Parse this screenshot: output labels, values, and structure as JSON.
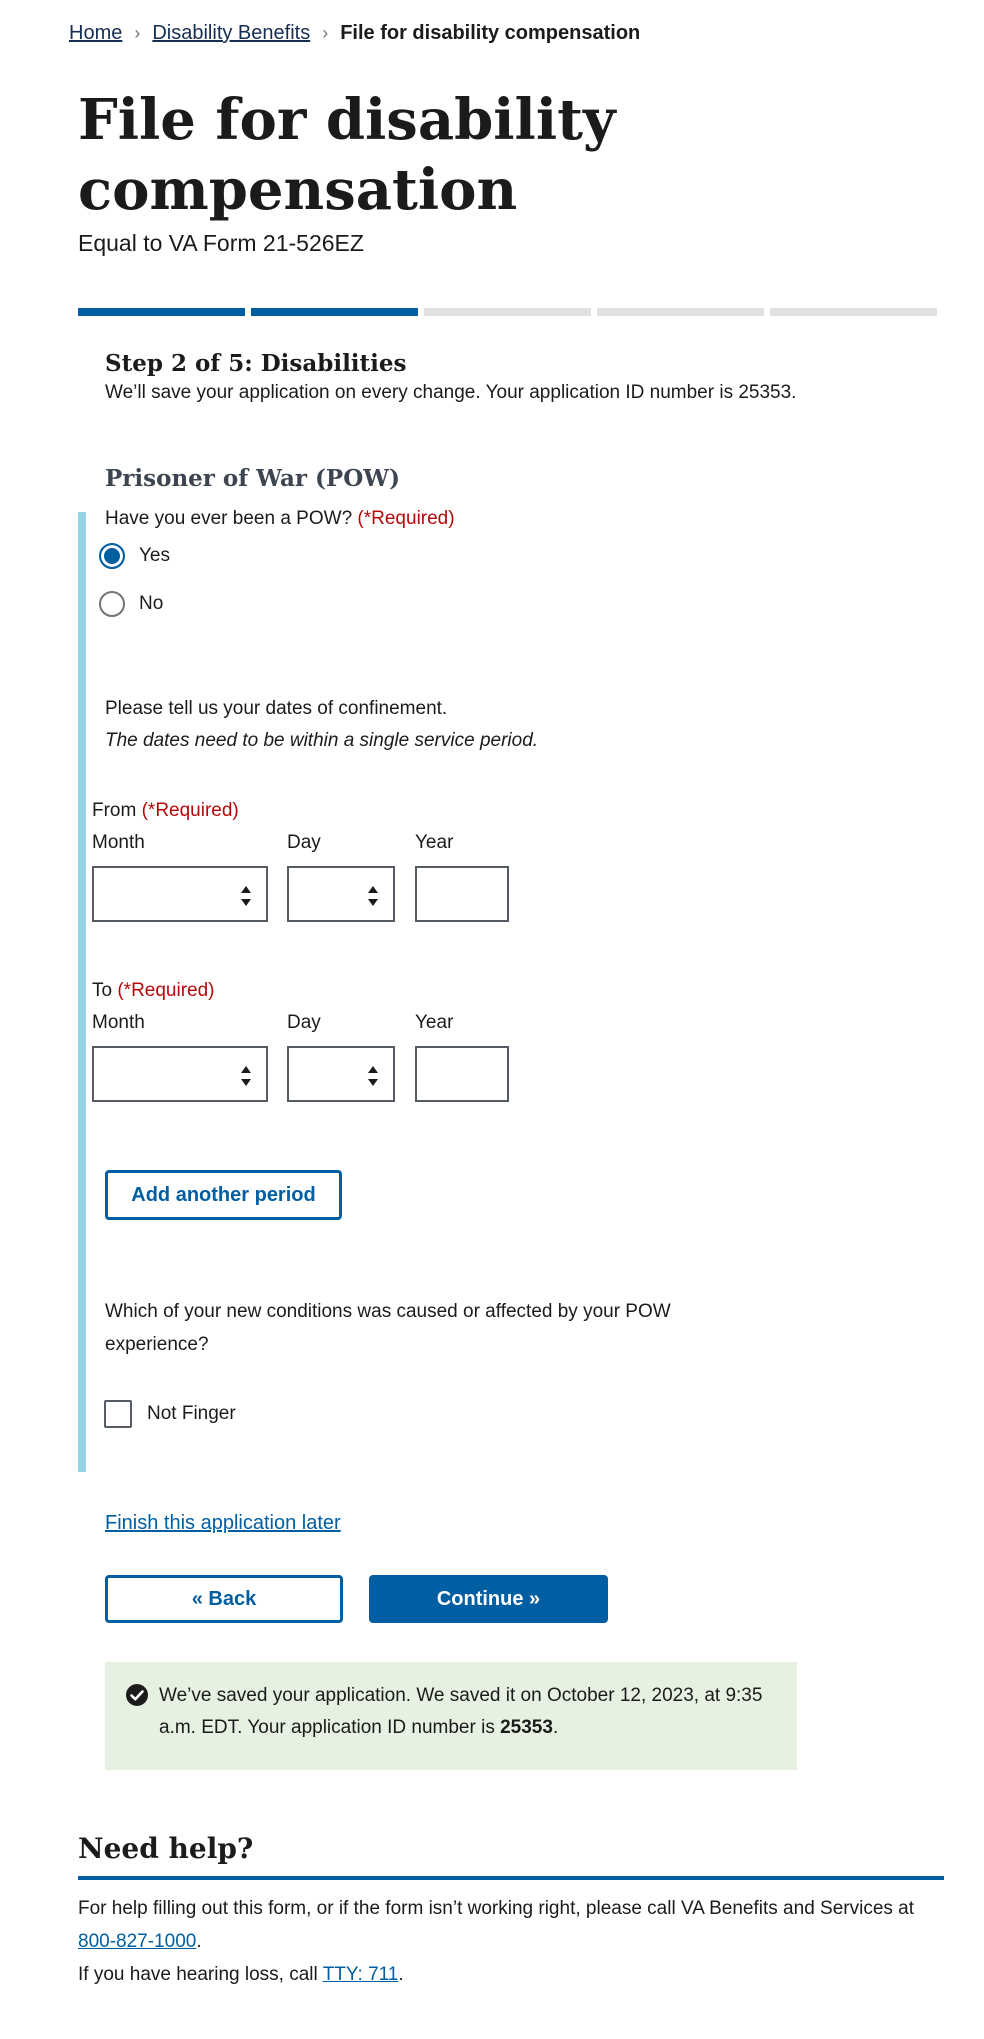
{
  "breadcrumb": {
    "items": [
      "Home",
      "Disability Benefits",
      "File for disability compensation"
    ],
    "separator": "›"
  },
  "header": {
    "title": "File for disability compensation",
    "subtitle": "Equal to VA Form 21-526EZ"
  },
  "progress": {
    "total_steps": 5,
    "completed_steps": 2
  },
  "step": {
    "heading": "Step 2 of 5: Disabilities",
    "note": "We’ll save your application on every change. Your application ID number is 25353."
  },
  "section": {
    "heading": "Prisoner of War (POW)",
    "question": "Have you ever been a POW?",
    "required": "(*Required)",
    "options": [
      "Yes",
      "No"
    ],
    "selected": "Yes",
    "dates_intro": "Please tell us your dates of confinement.",
    "dates_hint": "The dates need to be within a single service period.",
    "from_label": "From",
    "to_label": "To",
    "month_label": "Month",
    "day_label": "Day",
    "year_label": "Year",
    "add_period": "Add another period",
    "conditions_question": "Which of your new conditions was caused or affected by your POW experience?",
    "condition_option": "Not Finger"
  },
  "actions": {
    "finish_later": "Finish this application later",
    "back": "« Back",
    "continue": "Continue »"
  },
  "alert": {
    "text_before": "We’ve saved your application. We saved it on October 12, 2023, at 9:35 a.m. EDT. Your application ID number is ",
    "id": "25353",
    "text_after": "."
  },
  "help": {
    "heading": "Need help?",
    "line1_before": "For help filling out this form, or if the form isn’t working right, please call VA Benefits and Services at ",
    "phone": "800-827-1000",
    "line1_after": ".",
    "line2_before": "If you have hearing loss, call ",
    "tty": "TTY: 711",
    "line2_after": "."
  },
  "colors": {
    "primary": "#005ea2",
    "required": "#b50909",
    "accent_bar": "#97d4ea",
    "success_bg": "#e6f1e2"
  }
}
